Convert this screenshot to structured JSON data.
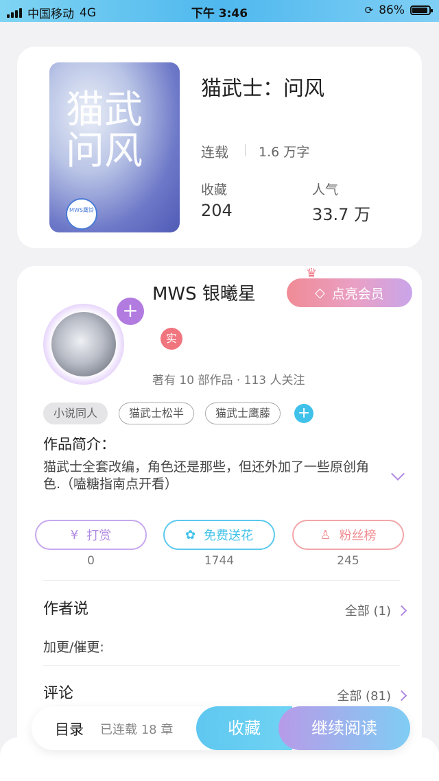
{
  "status_bar": {
    "carrier": "中国移动",
    "network": "4G",
    "time": "下午 3:46",
    "battery_percent": "86%"
  },
  "book": {
    "title": "猫武士：问风",
    "status": "连载",
    "word_count": "1.6 万字",
    "favorites_label": "收藏",
    "favorites_value": "204",
    "popularity_label": "人气",
    "popularity_value": "33.7 万",
    "cover_title_art": "猫武士问风",
    "cover_seal_text": "MWS 鹰铃"
  },
  "author": {
    "name": "MWS 银曦星",
    "vip_button": "点亮会员",
    "verified_badge": "实",
    "meta": "著有 10 部作品 · 113 人关注"
  },
  "tags": [
    "小说同人",
    "猫武士松半",
    "猫武士鹰藤"
  ],
  "intro": {
    "title": "作品简介：",
    "text": "猫武士全套改编，角色还是那些，但还外加了一些原创角色.（嗑糖指南点开看）"
  },
  "actions": [
    {
      "label": "打赏",
      "count": "0",
      "icon": "yen-coin-icon",
      "color": "#b08ae2"
    },
    {
      "label": "免费送花",
      "count": "1744",
      "icon": "flower-icon",
      "color": "#3fc1ea"
    },
    {
      "label": "粉丝榜",
      "count": "245",
      "icon": "fan-user-icon",
      "color": "#f08b8f"
    }
  ],
  "author_says": {
    "title": "作者说",
    "link": "全部 (1)",
    "content": "加更/催更:"
  },
  "comments": {
    "title": "评论",
    "link": "全部 (81)"
  },
  "bottom_bar": {
    "toc": "目录",
    "chapters": "已连载 18 章",
    "favorite": "收藏",
    "continue_reading": "继续阅读"
  }
}
